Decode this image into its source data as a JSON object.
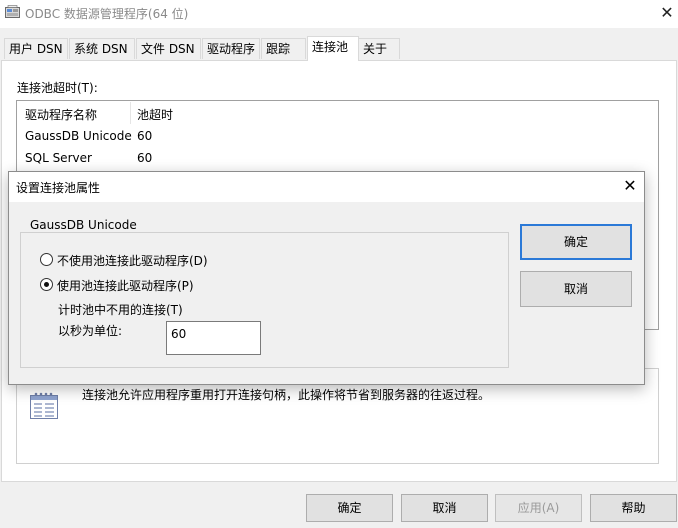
{
  "window": {
    "title": "ODBC 数据源管理程序(64 位)",
    "close_glyph": "✕"
  },
  "tabs": [
    {
      "label": "用户 DSN"
    },
    {
      "label": "系统 DSN"
    },
    {
      "label": "文件 DSN"
    },
    {
      "label": "驱动程序"
    },
    {
      "label": "跟踪"
    },
    {
      "label": "连接池",
      "active": true
    },
    {
      "label": "关于"
    }
  ],
  "pool_panel": {
    "timeout_label": "连接池超时(T):",
    "columns": [
      "驱动程序名称",
      "池超时"
    ],
    "rows": [
      {
        "driver": "GaussDB Unicode",
        "timeout": "60"
      },
      {
        "driver": "SQL Server",
        "timeout": "60"
      }
    ],
    "info_text": "连接池允许应用程序重用打开连接句柄，此操作将节省到服务器的往返过程。"
  },
  "dialog": {
    "title": "设置连接池属性",
    "close_glyph": "✕",
    "group_label": "GaussDB Unicode",
    "radio_disable": "不使用池连接此驱动程序(D)",
    "radio_enable": "使用池连接此驱动程序(P)",
    "radio_selected": "enable",
    "unused_timeout_label": "计时池中不用的连接(T)",
    "seconds_label": "以秒为单位:",
    "seconds_value": "60",
    "ok_label": "确定",
    "cancel_label": "取消"
  },
  "buttons": {
    "ok": "确定",
    "cancel": "取消",
    "apply": "应用(A)",
    "help": "帮助"
  },
  "colors": {
    "accent": "#2b79d7",
    "title_text": "#8a8a8a",
    "disabled_text": "#9a9a9a"
  },
  "icons": [
    "odbc-app-icon",
    "close-icon",
    "info-table-icon"
  ]
}
